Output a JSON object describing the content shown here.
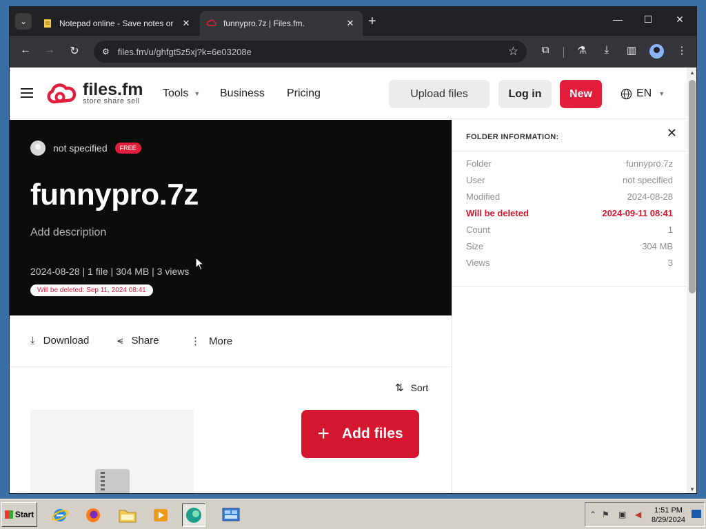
{
  "browser": {
    "tabs": [
      {
        "title": "Notepad online - Save notes or",
        "active": false
      },
      {
        "title": "funnypro.7z | Files.fm.",
        "active": true
      }
    ],
    "url": "files.fm/u/ghfgt5z5xj?k=6e03208e",
    "icons": {
      "tab_search": "chevron-down-icon",
      "new_tab": "plus-icon",
      "minimize": "minimize-icon",
      "maximize": "maximize-icon",
      "close": "close-icon",
      "back": "back-arrow-icon",
      "forward": "forward-arrow-icon",
      "reload": "reload-icon",
      "site_info": "tune-icon",
      "bookmark": "star-icon",
      "extensions": "puzzle-icon",
      "labs": "flask-icon",
      "downloads": "download-icon",
      "side_panel": "side-panel-icon",
      "profile": "profile-icon",
      "menu": "kebab-menu-icon"
    }
  },
  "site": {
    "logo": {
      "brand": "files.fm",
      "tagline": "store share sell"
    },
    "nav": [
      {
        "label": "Tools",
        "has_dropdown": true
      },
      {
        "label": "Business",
        "has_dropdown": false
      },
      {
        "label": "Pricing",
        "has_dropdown": false
      }
    ],
    "upload_label": "Upload files",
    "login_label": "Log in",
    "new_label": "New",
    "language": "EN",
    "accent_color": "#e31e3c"
  },
  "folder": {
    "owner": "not specified",
    "plan_badge": "FREE",
    "name": "funnypro.7z",
    "description_placeholder": "Add description",
    "meta_line": "2024-08-28 | 1 file | 304 MB | 3 views",
    "delete_notice": "Will be deleted: Sep 11, 2024 08:41"
  },
  "actions": {
    "download": "Download",
    "share": "Share",
    "more": "More",
    "sort": "Sort",
    "add_files": "Add files"
  },
  "info_panel": {
    "title": "FOLDER INFORMATION:",
    "rows": [
      {
        "label": "Folder",
        "value": "funnypro.7z"
      },
      {
        "label": "User",
        "value": "not specified"
      },
      {
        "label": "Modified",
        "value": "2024-08-28"
      },
      {
        "label": "Will be deleted",
        "value": "2024-09-11 08:41"
      },
      {
        "label": "Count",
        "value": "1"
      },
      {
        "label": "Size",
        "value": "304 MB"
      },
      {
        "label": "Views",
        "value": "3"
      }
    ]
  },
  "taskbar": {
    "start_label": "Start",
    "apps": [
      "internet-explorer-icon",
      "firefox-icon",
      "folder-icon",
      "media-player-icon",
      "edge-icon",
      "control-panel-icon"
    ],
    "clock_time": "1:51 PM",
    "clock_date": "8/29/2024"
  }
}
